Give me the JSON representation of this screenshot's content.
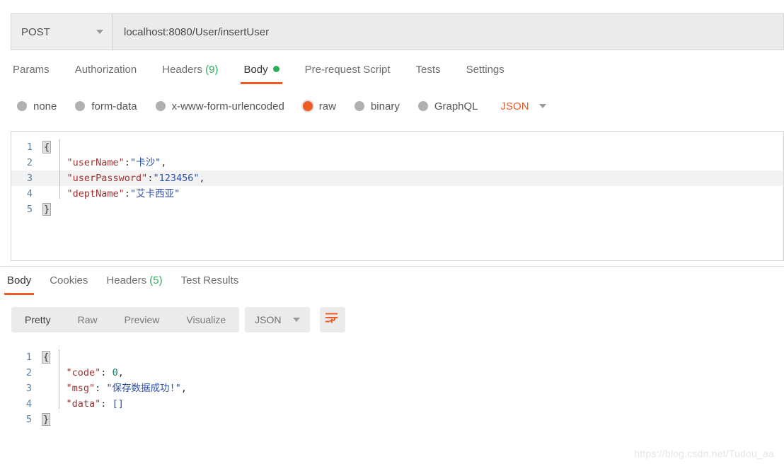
{
  "request_bar": {
    "method": "POST",
    "method_icon": "chevron-down-icon",
    "url": "localhost:8080/User/insertUser"
  },
  "request_tabs": [
    {
      "label": "Params",
      "active": false
    },
    {
      "label": "Authorization",
      "active": false
    },
    {
      "label": "Headers",
      "count": "(9)",
      "active": false
    },
    {
      "label": "Body",
      "active": true,
      "dot": "green"
    },
    {
      "label": "Pre-request Script",
      "active": false
    },
    {
      "label": "Tests",
      "active": false
    },
    {
      "label": "Settings",
      "active": false
    }
  ],
  "body_types": [
    {
      "label": "none",
      "selected": false
    },
    {
      "label": "form-data",
      "selected": false
    },
    {
      "label": "x-www-form-urlencoded",
      "selected": false
    },
    {
      "label": "raw",
      "selected": true
    },
    {
      "label": "binary",
      "selected": false
    },
    {
      "label": "GraphQL",
      "selected": false
    }
  ],
  "body_format": {
    "label": "JSON",
    "icon": "chevron-down-icon"
  },
  "request_body": {
    "active_line": 3,
    "lines": [
      {
        "no": "1",
        "tokens": [
          {
            "t": "{",
            "c": "brace"
          }
        ]
      },
      {
        "no": "2",
        "tokens": [
          {
            "t": "    ",
            "c": "p"
          },
          {
            "t": "\"userName\"",
            "c": "k"
          },
          {
            "t": ":",
            "c": "p"
          },
          {
            "t": "\"卡沙\"",
            "c": "s"
          },
          {
            "t": ",",
            "c": "p"
          }
        ]
      },
      {
        "no": "3",
        "tokens": [
          {
            "t": "    ",
            "c": "p"
          },
          {
            "t": "\"userPassword\"",
            "c": "k"
          },
          {
            "t": ":",
            "c": "p"
          },
          {
            "t": "\"123456\"",
            "c": "s"
          },
          {
            "t": ",",
            "c": "p"
          }
        ]
      },
      {
        "no": "4",
        "tokens": [
          {
            "t": "    ",
            "c": "p"
          },
          {
            "t": "\"deptName\"",
            "c": "k"
          },
          {
            "t": ":",
            "c": "p"
          },
          {
            "t": "\"艾卡西亚\"",
            "c": "s"
          }
        ]
      },
      {
        "no": "5",
        "tokens": [
          {
            "t": "}",
            "c": "brace"
          }
        ]
      }
    ]
  },
  "response_tabs": [
    {
      "label": "Body",
      "active": true
    },
    {
      "label": "Cookies",
      "active": false
    },
    {
      "label": "Headers",
      "count": "(5)",
      "active": false
    },
    {
      "label": "Test Results",
      "active": false
    }
  ],
  "response_toolbar": {
    "views": [
      {
        "label": "Pretty",
        "active": true
      },
      {
        "label": "Raw",
        "active": false
      },
      {
        "label": "Preview",
        "active": false
      },
      {
        "label": "Visualize",
        "active": false
      }
    ],
    "format": "JSON",
    "format_icon": "chevron-down-icon",
    "wrap_icon": "word-wrap-icon"
  },
  "response_body": {
    "lines": [
      {
        "no": "1",
        "tokens": [
          {
            "t": "{",
            "c": "brace"
          }
        ]
      },
      {
        "no": "2",
        "tokens": [
          {
            "t": "    ",
            "c": "p"
          },
          {
            "t": "\"code\"",
            "c": "k"
          },
          {
            "t": ": ",
            "c": "p"
          },
          {
            "t": "0",
            "c": "n"
          },
          {
            "t": ",",
            "c": "p"
          }
        ]
      },
      {
        "no": "3",
        "tokens": [
          {
            "t": "    ",
            "c": "p"
          },
          {
            "t": "\"msg\"",
            "c": "k"
          },
          {
            "t": ": ",
            "c": "p"
          },
          {
            "t": "\"保存数据成功!\"",
            "c": "s"
          },
          {
            "t": ",",
            "c": "p"
          }
        ]
      },
      {
        "no": "4",
        "tokens": [
          {
            "t": "    ",
            "c": "p"
          },
          {
            "t": "\"data\"",
            "c": "k"
          },
          {
            "t": ": ",
            "c": "p"
          },
          {
            "t": "[]",
            "c": "s"
          }
        ]
      },
      {
        "no": "5",
        "tokens": [
          {
            "t": "}",
            "c": "brace"
          }
        ]
      }
    ]
  },
  "watermark": "https://blog.csdn.net/Tudou_aa",
  "colors": {
    "accent": "#ef5b25",
    "success": "#2fab5a",
    "toolbar_bg": "#ebebeb",
    "json_key": "#a03030",
    "json_string": "#2b4ea2",
    "json_number": "#1a7a6e"
  }
}
